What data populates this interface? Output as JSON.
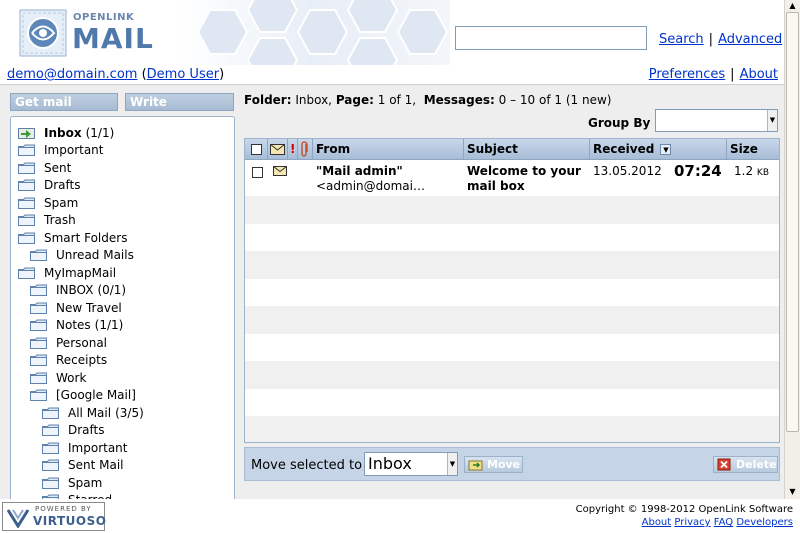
{
  "header": {
    "logo_small": "OPENLINK",
    "logo_big": "MAIL",
    "search_value": "",
    "search_link": "Search",
    "advanced_link": "Advanced"
  },
  "userbar": {
    "email": "demo@domain.com",
    "user_name": "Demo User",
    "preferences": "Preferences",
    "about": "About"
  },
  "sidebar": {
    "get_mail": "Get mail",
    "write": "Write",
    "folders": [
      {
        "label": "Inbox",
        "count": "(1/1)",
        "level": 0,
        "bold": true,
        "icon": "inbox-icon"
      },
      {
        "label": "Important",
        "count": "",
        "level": 0
      },
      {
        "label": "Sent",
        "count": "",
        "level": 0
      },
      {
        "label": "Drafts",
        "count": "",
        "level": 0
      },
      {
        "label": "Spam",
        "count": "",
        "level": 0
      },
      {
        "label": "Trash",
        "count": "",
        "level": 0
      },
      {
        "label": "Smart Folders",
        "count": "",
        "level": 0
      },
      {
        "label": "Unread Mails",
        "count": "",
        "level": 1
      },
      {
        "label": "MyImapMail",
        "count": "",
        "level": 0
      },
      {
        "label": "INBOX",
        "count": "(0/1)",
        "level": 1
      },
      {
        "label": "New Travel",
        "count": "",
        "level": 1
      },
      {
        "label": "Notes",
        "count": "(1/1)",
        "level": 1
      },
      {
        "label": "Personal",
        "count": "",
        "level": 1
      },
      {
        "label": "Receipts",
        "count": "",
        "level": 1
      },
      {
        "label": "Work",
        "count": "",
        "level": 1
      },
      {
        "label": "[Google Mail]",
        "count": "",
        "level": 1
      },
      {
        "label": "All Mail",
        "count": "(3/5)",
        "level": 2
      },
      {
        "label": "Drafts",
        "count": "",
        "level": 2
      },
      {
        "label": "Important",
        "count": "",
        "level": 2
      },
      {
        "label": "Sent Mail",
        "count": "",
        "level": 2
      },
      {
        "label": "Spam",
        "count": "",
        "level": 2
      },
      {
        "label": "Starred",
        "count": "",
        "level": 2
      }
    ]
  },
  "main": {
    "folder_label": "Folder:",
    "folder_name": "Inbox,",
    "page_label": "Page:",
    "page_value": "1 of 1,",
    "messages_label": "Messages:",
    "messages_value": "0 – 10 of 1 (1 new)",
    "group_by_label": "Group By",
    "group_by_value": ""
  },
  "grid": {
    "columns": {
      "from": "From",
      "subject": "Subject",
      "received": "Received",
      "size": "Size"
    },
    "messages": [
      {
        "from_line1": "\"Mail admin\"",
        "from_line2": "<admin@domai…",
        "subject_line1": "Welcome to your",
        "subject_line2": "mail box",
        "received_date": "13.05.2012",
        "received_time": "07:24",
        "size": "1.2",
        "size_unit": "KB"
      }
    ]
  },
  "movebar": {
    "label": "Move selected to",
    "target": "Inbox",
    "move_button": "Move",
    "delete_button": "Delete"
  },
  "footer": {
    "powered_by": "POWERED BY",
    "virtuoso": "VIRTUOSO",
    "copyright": "Copyright © 1998-2012 OpenLink Software",
    "links": [
      "About",
      "Privacy",
      "FAQ",
      "Developers"
    ]
  },
  "colors": {
    "accent": "#4f78ab",
    "link": "#0033cc",
    "header_grad_top": "#c9d8ea",
    "header_grad_bottom": "#a7bdd7"
  }
}
